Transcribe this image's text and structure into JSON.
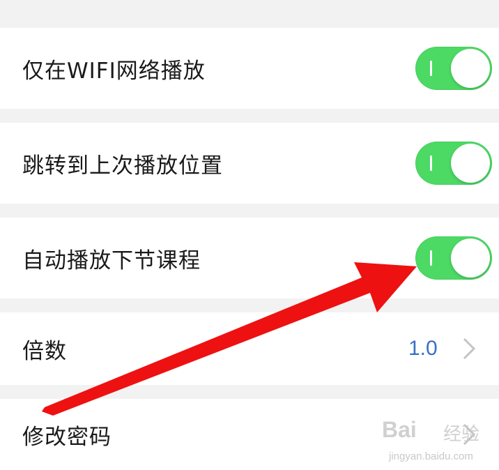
{
  "settings": {
    "wifi_only": {
      "label": "仅在WIFI网络播放",
      "enabled": true
    },
    "resume_position": {
      "label": "跳转到上次播放位置",
      "enabled": true
    },
    "autoplay_next": {
      "label": "自动播放下节课程",
      "enabled": true
    },
    "speed": {
      "label": "倍数",
      "value": "1.0"
    },
    "change_password": {
      "label": "修改密码"
    }
  },
  "colors": {
    "toggle_on": "#4cd964",
    "value_text": "#3a6fc4",
    "annotation_arrow": "#ee1111",
    "background": "#f2f2f2"
  },
  "watermark": {
    "logo": "Bai",
    "cn": "经验",
    "url": "jingyan.baidu.com"
  }
}
